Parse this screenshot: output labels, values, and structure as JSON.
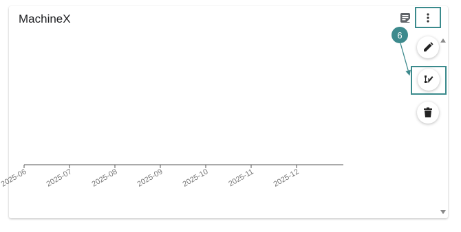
{
  "widget": {
    "title": "MachineX"
  },
  "annotation": {
    "step_number": "6"
  },
  "icons": {
    "note": "note-icon",
    "menu": "more-vert-icon",
    "edit": "pencil-icon",
    "flow": "schema-flow-icon",
    "delete": "trash-icon"
  },
  "colors": {
    "highlight": "#3a8a8c",
    "badge": "#3d8a8d",
    "axis": "#555555"
  },
  "chart_data": {
    "type": "line",
    "x": [
      "2025-06",
      "2025-07",
      "2025-08",
      "2025-09",
      "2025-10",
      "2025-11",
      "2025-12"
    ],
    "series": [],
    "title": "",
    "xlabel": "",
    "ylabel": ""
  }
}
